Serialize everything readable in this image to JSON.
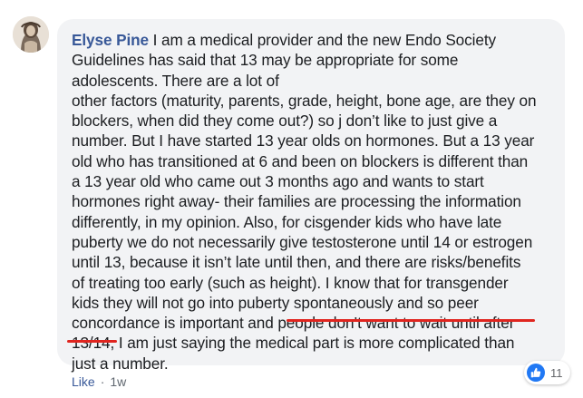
{
  "comment": {
    "author": "Elyse Pine",
    "lines": [
      " I am a medical provider and the new Endo Society",
      "Guidelines has said that 13 may be appropriate for some",
      "adolescents. There are a lot of",
      "other factors (maturity, parents, grade, height, bone age, are they on",
      "blockers, when did they come out?) so j don’t like to just give a",
      "number. But I have started 13 year olds on hormones. But a 13 year",
      "old who has transitioned at 6 and been on blockers is different than",
      "a 13 year old who came out 3 months ago and wants to start",
      "hormones right away- their families are processing the information",
      "differently, in my opinion. Also, for cisgender kids who have late",
      "puberty we do not necessarily give testosterone until 14 or estrogen",
      "until 13, because it isn’t late until then, and there are risks/benefits",
      "of treating too early (such as height). I know that for transgender",
      "kids they will not go into puberty spontaneously and so peer",
      "concordance is important and people don’t want to wait until after",
      "13/14, I am just saying the medical part is more complicated than",
      "just a number."
    ]
  },
  "actions": {
    "like_label": "Like",
    "separator": "·",
    "time": "1w"
  },
  "reactions": {
    "count": "11",
    "icon": "thumbs-up-icon",
    "badge_color": "#2078f4"
  },
  "colors": {
    "author": "#385898",
    "underline": "#e0251f",
    "bubble": "#f2f3f5"
  }
}
